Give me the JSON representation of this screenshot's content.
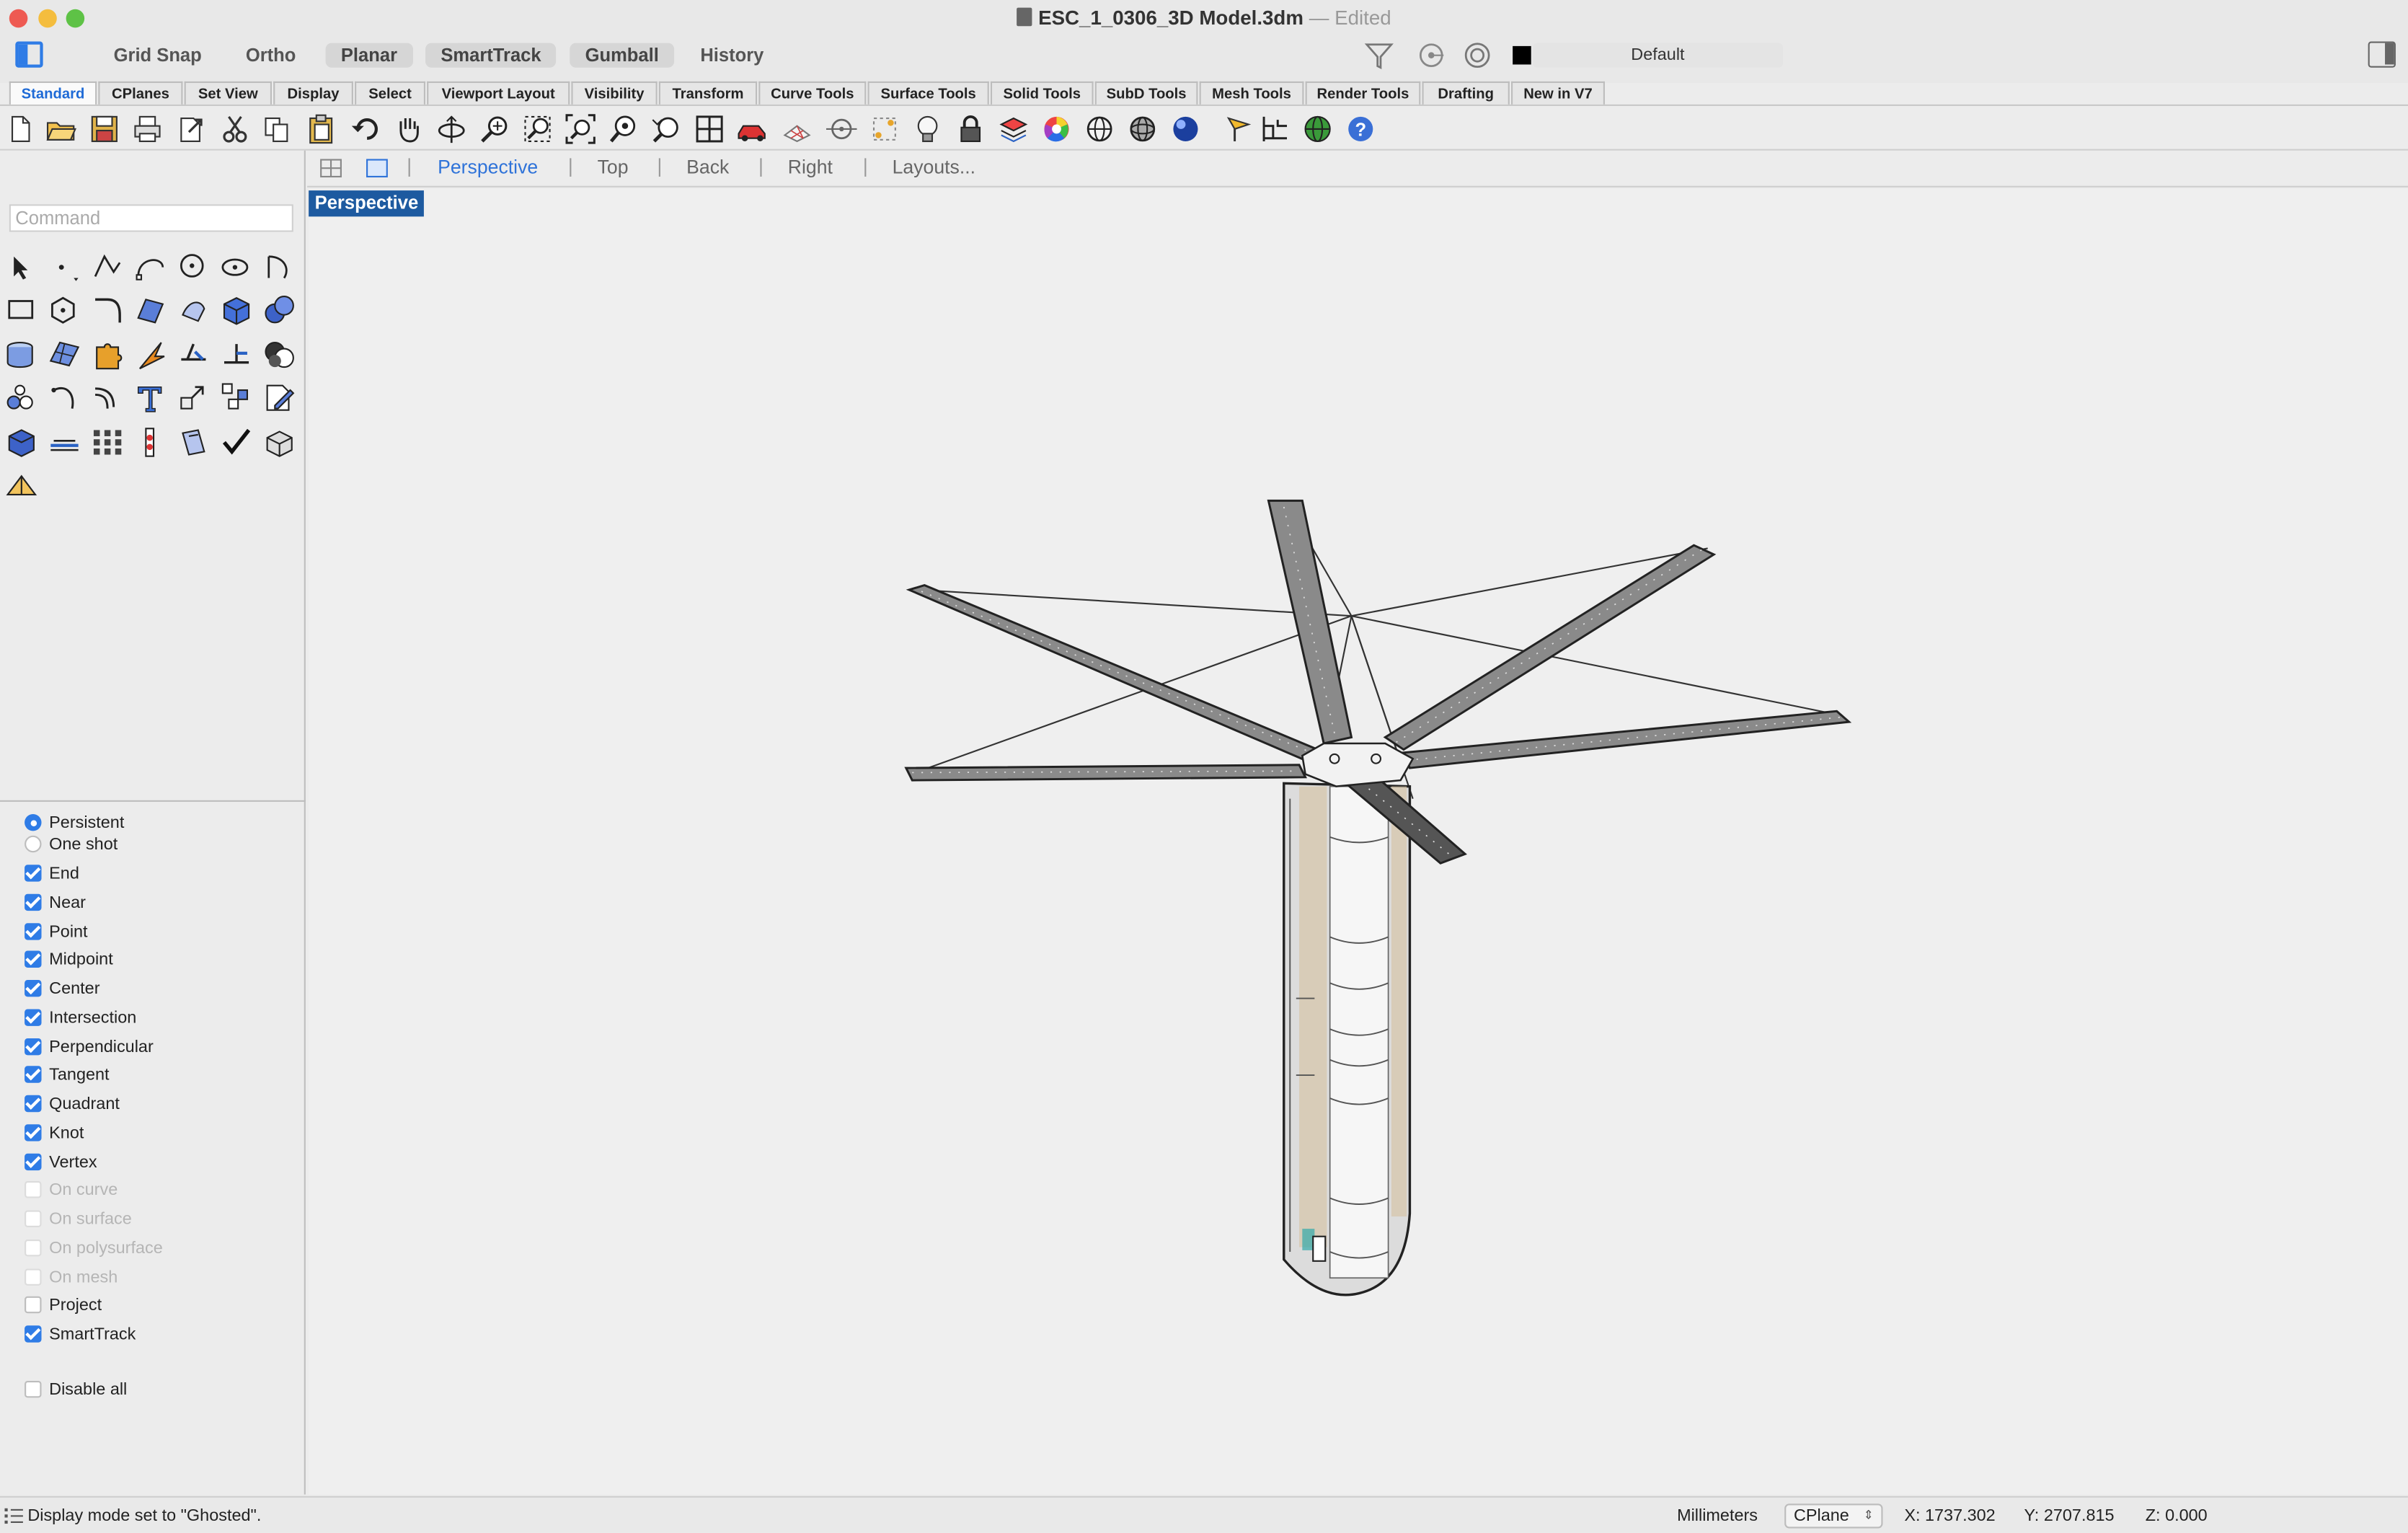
{
  "window": {
    "title": "ESC_1_0306_3D Model.3dm",
    "title_separator": "—",
    "edited_label": "Edited"
  },
  "toolbar": {
    "grid_snap": "Grid Snap",
    "ortho": "Ortho",
    "planar": "Planar",
    "smarttrack": "SmartTrack",
    "gumball": "Gumball",
    "history": "History",
    "layer": "Default"
  },
  "tabs": [
    "Standard",
    "CPlanes",
    "Set View",
    "Display",
    "Select",
    "Viewport Layout",
    "Visibility",
    "Transform",
    "Curve Tools",
    "Surface Tools",
    "Solid Tools",
    "SubD Tools",
    "Mesh Tools",
    "Render Tools",
    "Drafting",
    "New in V7"
  ],
  "command": {
    "placeholder": "Command"
  },
  "viewport_tabs": {
    "perspective": "Perspective",
    "top": "Top",
    "back": "Back",
    "right": "Right",
    "layouts": "Layouts..."
  },
  "viewport": {
    "label": "Perspective"
  },
  "osnap": {
    "persistent": "Persistent",
    "one_shot": "One shot",
    "items": [
      {
        "label": "End",
        "checked": true
      },
      {
        "label": "Near",
        "checked": true
      },
      {
        "label": "Point",
        "checked": true
      },
      {
        "label": "Midpoint",
        "checked": true
      },
      {
        "label": "Center",
        "checked": true
      },
      {
        "label": "Intersection",
        "checked": true
      },
      {
        "label": "Perpendicular",
        "checked": true
      },
      {
        "label": "Tangent",
        "checked": true
      },
      {
        "label": "Quadrant",
        "checked": true
      },
      {
        "label": "Knot",
        "checked": true
      },
      {
        "label": "Vertex",
        "checked": true
      },
      {
        "label": "On curve",
        "checked": false,
        "disabled": true
      },
      {
        "label": "On surface",
        "checked": false,
        "disabled": true
      },
      {
        "label": "On polysurface",
        "checked": false,
        "disabled": true
      },
      {
        "label": "On mesh",
        "checked": false,
        "disabled": true
      },
      {
        "label": "Project",
        "checked": false
      },
      {
        "label": "SmartTrack",
        "checked": true
      }
    ],
    "disable_all": "Disable all"
  },
  "status": {
    "message": "Display mode set to \"Ghosted\".",
    "units": "Millimeters",
    "cplane": "CPlane",
    "x": "X: 1737.302",
    "y": "Y: 2707.815",
    "z": "Z: 0.000"
  },
  "colors": {
    "accent": "#2f7ce6",
    "viewport_label_bg": "#1d5aa0",
    "active_tab": "#1e6ad6"
  },
  "icons": [
    "new-file-icon",
    "open-folder-icon",
    "save-icon",
    "print-icon",
    "export-icon",
    "cut-icon",
    "copy-icon",
    "paste-icon",
    "undo-icon",
    "pan-hand-icon",
    "rotate-view-icon",
    "zoom-icon",
    "zoom-window-icon",
    "zoom-extents-icon",
    "zoom-selected-icon",
    "undo-view-icon",
    "four-viewports-icon",
    "car-render-icon",
    "grid-icon",
    "snap-icon",
    "points-icon",
    "light-bulb-icon",
    "lock-icon",
    "layer-icon",
    "color-wheel-icon",
    "shade-sphere-icon",
    "wireframe-sphere-icon",
    "render-sphere-icon",
    "cplane-icon",
    "dimension-icon",
    "globe-icon",
    "help-icon"
  ]
}
